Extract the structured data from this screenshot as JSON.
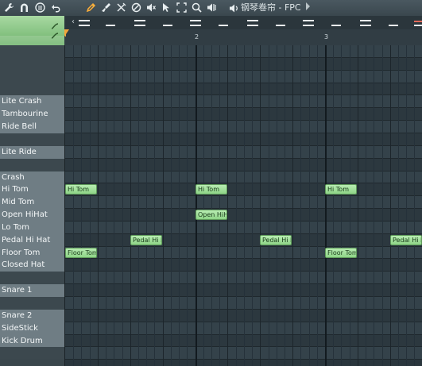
{
  "window": {
    "title": "钢琴卷帘 - FPC"
  },
  "toolbar": {
    "tools": [
      {
        "icon": "wrench-icon"
      },
      {
        "icon": "magnet-icon"
      },
      {
        "icon": "menu-icon"
      },
      {
        "icon": "undo-icon"
      },
      {
        "icon": "pencil-icon"
      },
      {
        "icon": "brush-icon"
      },
      {
        "icon": "delete-icon"
      },
      {
        "icon": "mute-icon"
      },
      {
        "icon": "speaker-mute-icon"
      },
      {
        "icon": "select-icon"
      },
      {
        "icon": "slice-icon"
      },
      {
        "icon": "zoom-icon"
      },
      {
        "icon": "playback-icon"
      }
    ],
    "accent_color": "#ffb03a"
  },
  "ruler": {
    "bars": [
      "2",
      "3"
    ]
  },
  "instruments": [
    {
      "label": ""
    },
    {
      "label": ""
    },
    {
      "label": ""
    },
    {
      "label": ""
    },
    {
      "label": "Lite Crash"
    },
    {
      "label": "Tambourine"
    },
    {
      "label": "Ride Bell"
    },
    {
      "label": ""
    },
    {
      "label": "Lite Ride"
    },
    {
      "label": ""
    },
    {
      "label": "Crash"
    },
    {
      "label": "Hi Tom"
    },
    {
      "label": "Mid Tom"
    },
    {
      "label": "Open HiHat"
    },
    {
      "label": "Lo Tom"
    },
    {
      "label": "Pedal Hi Hat"
    },
    {
      "label": "Floor Tom"
    },
    {
      "label": "Closed Hat"
    },
    {
      "label": ""
    },
    {
      "label": "Snare 1"
    },
    {
      "label": ""
    },
    {
      "label": "Snare 2"
    },
    {
      "label": "SideStick"
    },
    {
      "label": "Kick Drum"
    },
    {
      "label": ""
    }
  ],
  "notes": [
    {
      "label": "Hi Tom",
      "row": 11,
      "step": 0
    },
    {
      "label": "Hi Tom",
      "row": 11,
      "step": 16
    },
    {
      "label": "Hi Tom",
      "row": 11,
      "step": 32
    },
    {
      "label": "Open HiHat",
      "row": 13,
      "step": 16
    },
    {
      "label": "Pedal Hi H.",
      "row": 15,
      "step": 8
    },
    {
      "label": "Pedal Hi H.",
      "row": 15,
      "step": 24
    },
    {
      "label": "Pedal Hi H.",
      "row": 15,
      "step": 40
    },
    {
      "label": "Floor Tom",
      "row": 16,
      "step": 0
    },
    {
      "label": "Floor Tom",
      "row": 16,
      "step": 32
    }
  ],
  "colors": {
    "note_fill": "#a6e2a0",
    "note_text": "#1a3b1a",
    "playhead": "#f3a53a",
    "corner_tab": "#8fcb8a"
  }
}
